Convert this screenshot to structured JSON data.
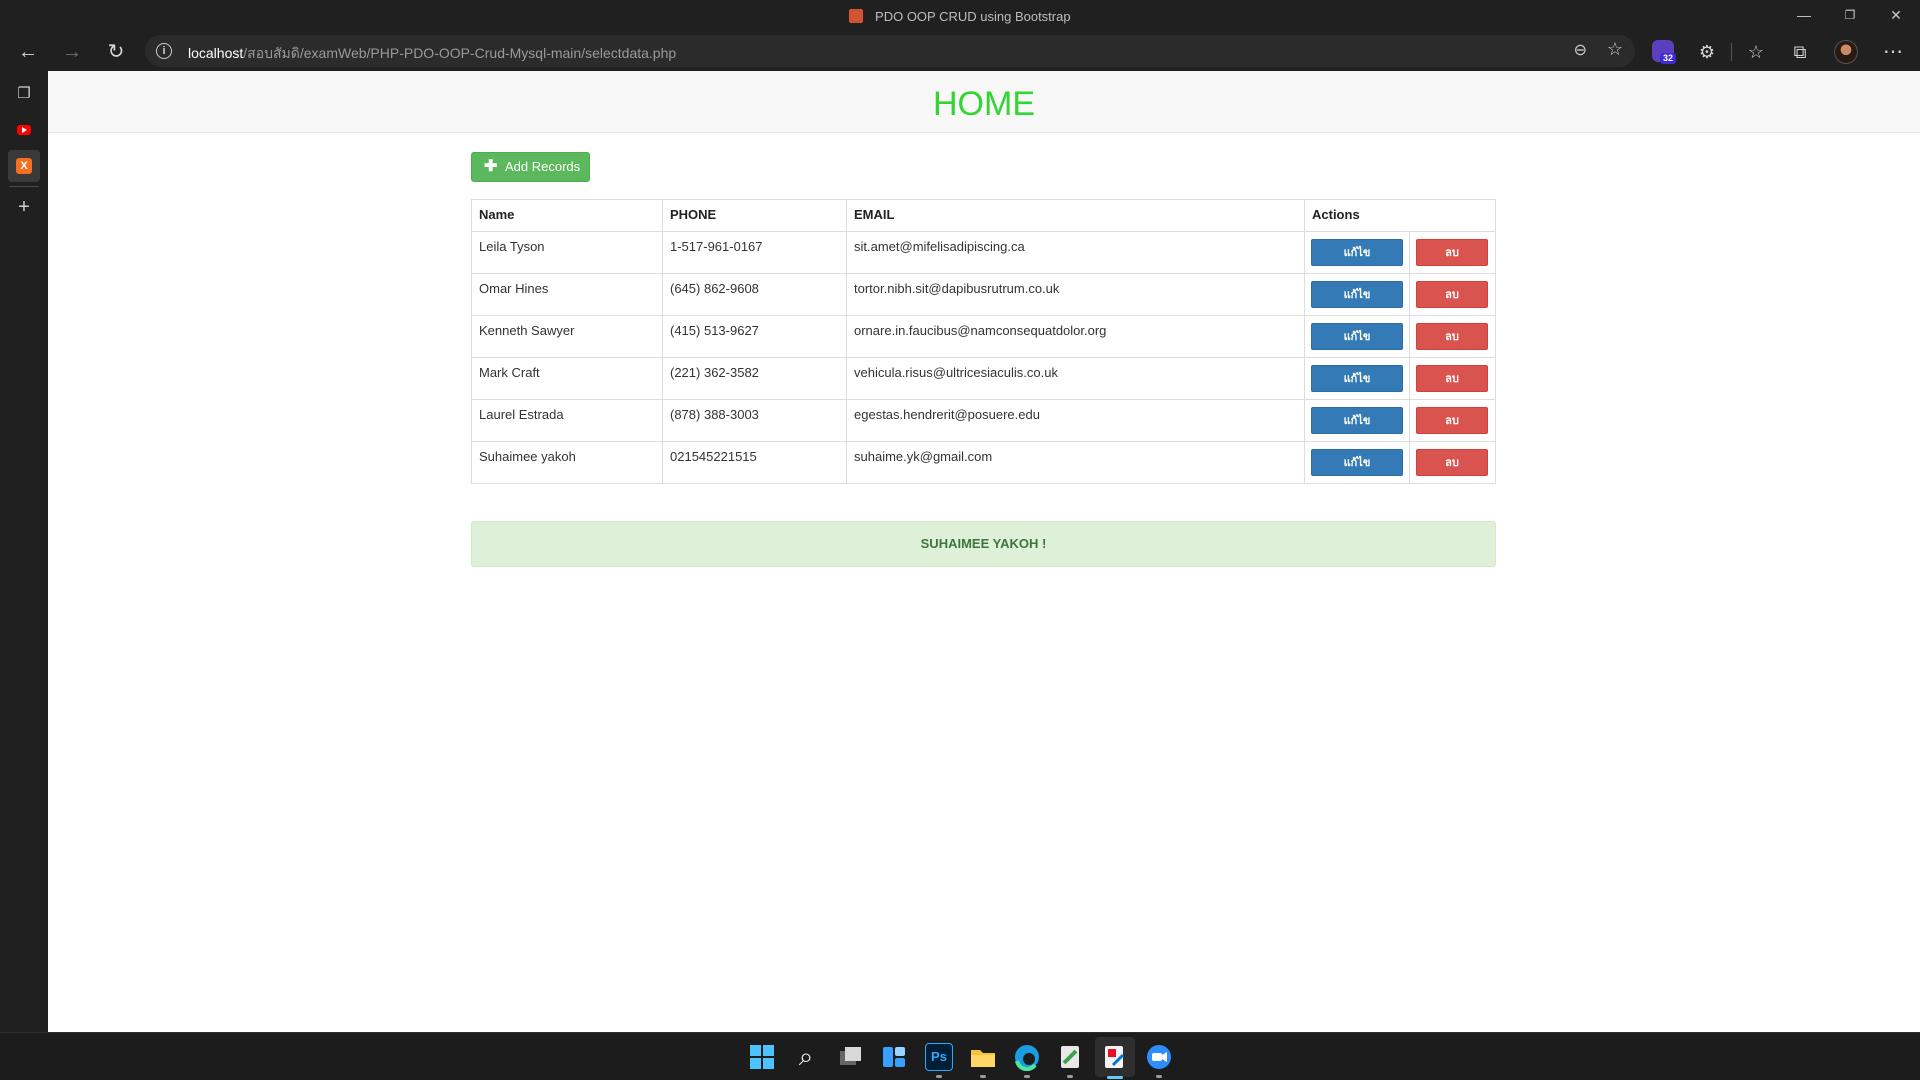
{
  "window": {
    "title": "PDO OOP CRUD using Bootstrap",
    "controls": {
      "minimize": "—",
      "restore": "❐",
      "close": "✕"
    }
  },
  "toolbar": {
    "back_icon": "←",
    "forward_icon": "→",
    "reload_icon": "↻",
    "info_icon": "i",
    "url_host": "localhost",
    "url_path": "/สอบสัมดิ/examWeb/PHP-PDO-OOP-Crud-Mysql-main/selectdata.php",
    "zoom_icon": "⊖",
    "favorite_icon": "☆",
    "extension_badge": "32",
    "extensions_icon": "⚙",
    "favorites_icon": "☆",
    "collections_icon": "⧉",
    "menu_icon": "⋯"
  },
  "sidebar": {
    "tab_actions_icon": "❐",
    "add_tab_icon": "+",
    "xampp_glyph": "X"
  },
  "page": {
    "title": "HOME",
    "add_button": {
      "icon": "✚",
      "label": "Add Records"
    },
    "table": {
      "headers": {
        "name": "Name",
        "phone": "PHONE",
        "email": "EMAIL",
        "actions": "Actions"
      },
      "edit_label": "แก้ไข",
      "delete_label": "ลบ",
      "rows": [
        {
          "name": "Leila Tyson",
          "phone": "1-517-961-0167",
          "email": "sit.amet@mifelisadipiscing.ca"
        },
        {
          "name": "Omar Hines",
          "phone": "(645) 862-9608",
          "email": "tortor.nibh.sit@dapibusrutrum.co.uk"
        },
        {
          "name": "Kenneth Sawyer",
          "phone": "(415) 513-9627",
          "email": "ornare.in.faucibus@namconsequatdolor.org"
        },
        {
          "name": "Mark Craft",
          "phone": "(221) 362-3582",
          "email": "vehicula.risus@ultricesiaculis.co.uk"
        },
        {
          "name": "Laurel Estrada",
          "phone": "(878) 388-3003",
          "email": "egestas.hendrerit@posuere.edu"
        },
        {
          "name": "Suhaimee yakoh",
          "phone": "021545221515",
          "email": "suhaime.yk@gmail.com"
        }
      ]
    },
    "alert": "SUHAIMEE YAKOH !"
  },
  "taskbar": {
    "photoshop_glyph": "Ps",
    "search_glyph": "⌕"
  },
  "colors": {
    "title_green": "#32d532",
    "add_green": "#5cb85c",
    "edit_blue": "#337ab7",
    "delete_red": "#d9534f",
    "alert_bg": "#dff0d8",
    "alert_text": "#3c763d"
  }
}
